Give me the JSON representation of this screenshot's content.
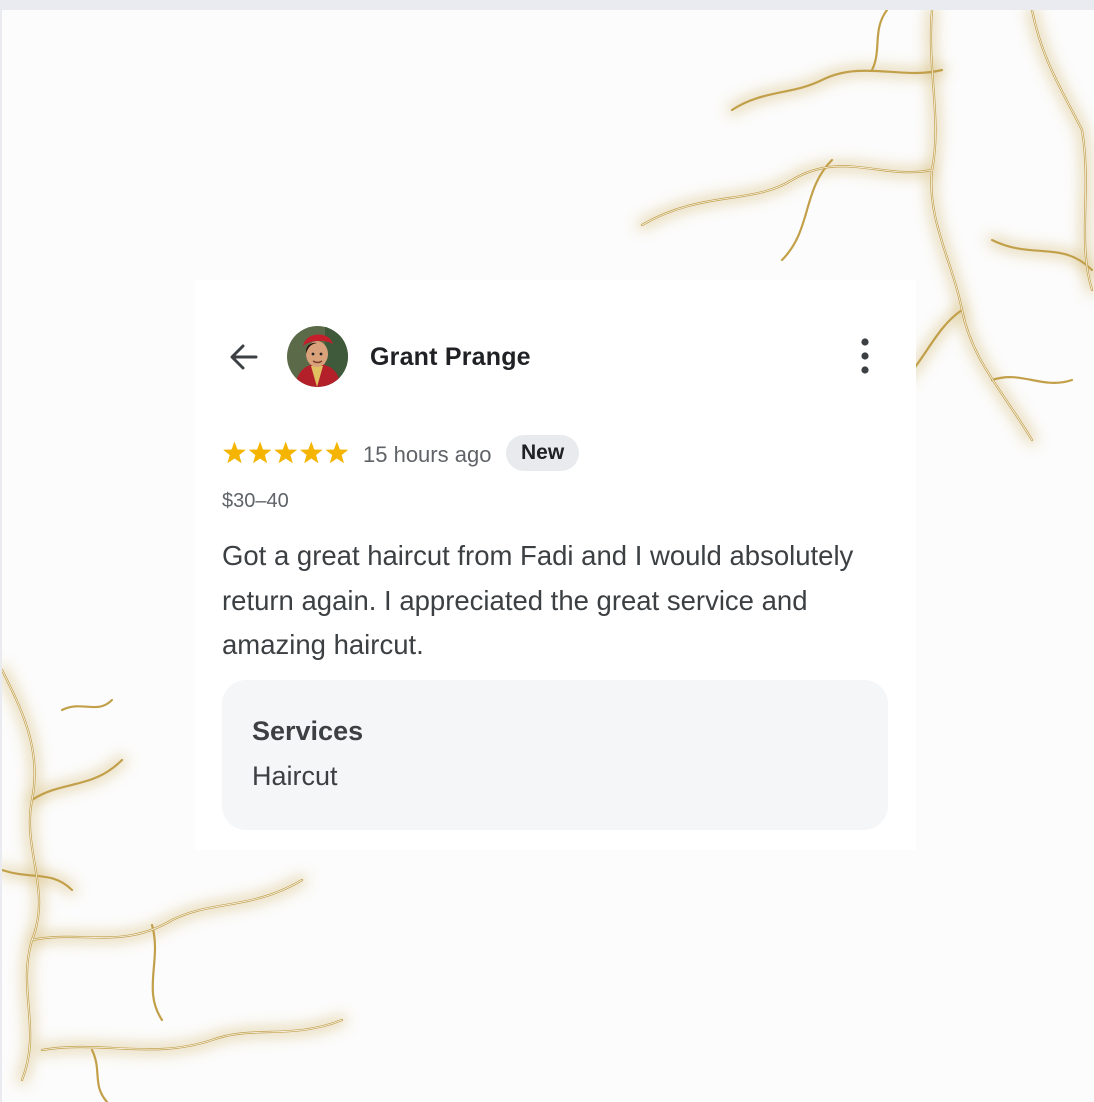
{
  "review": {
    "author": "Grant Prange",
    "rating": 5,
    "rating_max": 5,
    "time": "15 hours ago",
    "badge": "New",
    "price": "$30–40",
    "text": "Got a great haircut from Fadi and I would absolutely return again. I appreciated the great service and amazing haircut.",
    "services_label": "Services",
    "services_value": "Haircut"
  },
  "icons": {
    "back": "arrow-left-icon",
    "more": "more-vert-icon",
    "star": "star-icon"
  },
  "colors": {
    "star": "#f4b400",
    "decoration": "#c8a650"
  }
}
